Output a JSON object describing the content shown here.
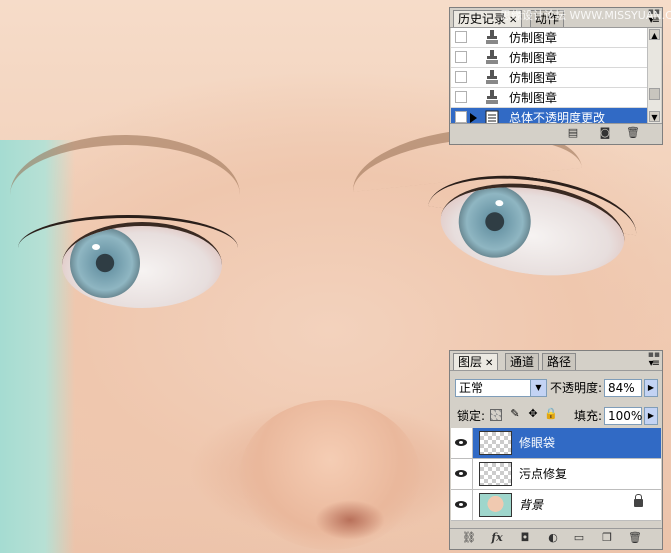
{
  "watermark": "思缘设计论坛 WWW.MISSYUAN.COM",
  "history_panel": {
    "tabs": [
      {
        "label": "历史记录",
        "active": true
      },
      {
        "label": "动作",
        "active": false
      }
    ],
    "states": [
      {
        "label": "仿制图章",
        "icon": "clone-stamp-icon",
        "selected": false
      },
      {
        "label": "仿制图章",
        "icon": "clone-stamp-icon",
        "selected": false
      },
      {
        "label": "仿制图章",
        "icon": "clone-stamp-icon",
        "selected": false
      },
      {
        "label": "仿制图章",
        "icon": "clone-stamp-icon",
        "selected": false
      },
      {
        "label": "总体不透明度更改",
        "icon": "history-state-icon",
        "selected": true
      }
    ],
    "footer_icons": [
      "new-document-from-state-icon",
      "new-snapshot-icon",
      "delete-state-icon"
    ]
  },
  "layers_panel": {
    "tabs": [
      {
        "label": "图层",
        "active": true
      },
      {
        "label": "通道",
        "active": false
      },
      {
        "label": "路径",
        "active": false
      }
    ],
    "blend_mode": "正常",
    "opacity_label": "不透明度:",
    "opacity_value": "84%",
    "lock_label": "锁定:",
    "fill_label": "填充:",
    "fill_value": "100%",
    "layers": [
      {
        "name": "修眼袋",
        "selected": true,
        "thumb": "transparent",
        "visible": true
      },
      {
        "name": "污点修复",
        "selected": false,
        "thumb": "transparent",
        "visible": true
      },
      {
        "name": "背景",
        "selected": false,
        "thumb": "photo",
        "visible": true,
        "locked": true
      }
    ],
    "footer_icons": [
      "link-layers-icon",
      "fx-icon",
      "add-mask-icon",
      "adjustment-layer-icon",
      "new-group-icon",
      "new-layer-icon",
      "delete-layer-icon"
    ]
  },
  "colors": {
    "selection": "#316ac5",
    "panel_bg": "#d4d0c8"
  }
}
